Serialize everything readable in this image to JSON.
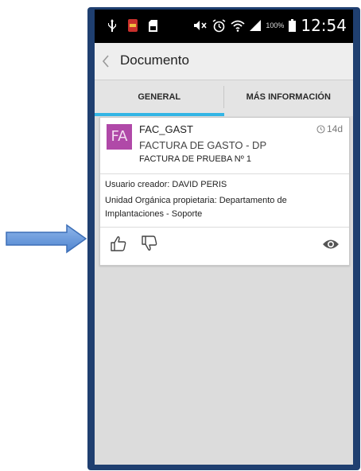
{
  "status_bar": {
    "battery_percent": "100%",
    "time": "12:54"
  },
  "action_bar": {
    "title": "Documento"
  },
  "tabs": [
    {
      "label": "GENERAL",
      "selected": true
    },
    {
      "label": "MÁS INFORMACIÓN",
      "selected": false
    }
  ],
  "card": {
    "avatar_initials": "FA",
    "avatar_color": "#b049a8",
    "code": "FAC_GAST",
    "age": "14d",
    "doc_type": "FACTURA DE GASTO - DP",
    "doc_name": "FACTURA DE PRUEBA Nº 1",
    "creator": "Usuario creador: DAVID PERIS",
    "unit": "Unidad Orgánica propietaria: Departamento de Implantaciones - Soporte",
    "actions": {
      "like_icon": "thumbs-up-icon",
      "dislike_icon": "thumbs-down-icon",
      "view_icon": "eye-icon"
    }
  },
  "colors": {
    "tab_indicator": "#33b5e5",
    "frame": "#1f3f70",
    "arrow": "#5b8fd6"
  }
}
